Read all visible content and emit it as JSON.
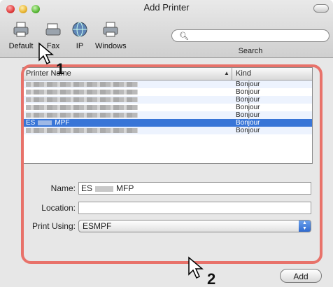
{
  "window": {
    "title": "Add Printer"
  },
  "toolbar": [
    {
      "label": "Default",
      "icon": "printer-icon"
    },
    {
      "label": "Fax",
      "icon": "fax-icon"
    },
    {
      "label": "IP",
      "icon": "globe-icon"
    },
    {
      "label": "Windows",
      "icon": "windows-printer-icon"
    }
  ],
  "search": {
    "label": "Search",
    "placeholder": ""
  },
  "printer_list": {
    "columns": [
      "Printer Name",
      "Kind"
    ],
    "rows": [
      {
        "name": "",
        "kind": "Bonjour",
        "selected": false
      },
      {
        "name": "",
        "kind": "Bonjour",
        "selected": false
      },
      {
        "name": "",
        "kind": "Bonjour",
        "selected": false
      },
      {
        "name": "",
        "kind": "Bonjour",
        "selected": false
      },
      {
        "name": "",
        "kind": "Bonjour",
        "selected": false
      },
      {
        "name_prefix": "ES",
        "name_suffix": "MPF",
        "kind": "Bonjour",
        "selected": true
      },
      {
        "name": "",
        "kind": "Bonjour",
        "selected": false
      }
    ]
  },
  "form": {
    "name_label": "Name:",
    "name_prefix": "ES",
    "name_suffix": "MFP",
    "location_label": "Location:",
    "location_value": "",
    "print_using_label": "Print Using:",
    "print_using_prefix": "ES",
    "print_using_suffix": "MPF"
  },
  "buttons": {
    "add": "Add"
  },
  "callouts": {
    "one": "1",
    "two": "2"
  },
  "colors": {
    "highlight": "#e8726a",
    "selection": "#3875d7"
  }
}
